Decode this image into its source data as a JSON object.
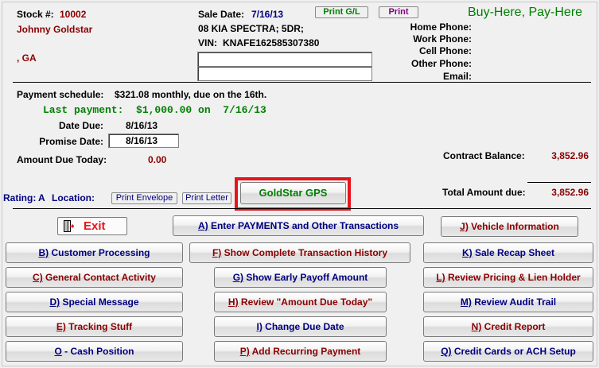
{
  "header": {
    "stock_label": "Stock #:",
    "stock_number": "10002",
    "customer_name": "Johnny Goldstar",
    "location_line": ", GA",
    "sale_date_label": "Sale Date:",
    "sale_date": "7/16/13",
    "vehicle": "08 KIA SPECTRA; 5DR;",
    "vin_label": "VIN:",
    "vin": "KNAFE162585307380",
    "print_gl_label": "Print G/L",
    "print_label": "Print",
    "brand": "Buy-Here, Pay-Here",
    "text_field_1": "",
    "text_field_2": ""
  },
  "phones": {
    "home_label": "Home Phone:",
    "work_label": "Work Phone:",
    "cell_label": "Cell Phone:",
    "other_label": "Other Phone:",
    "email_label": "Email:"
  },
  "payment": {
    "schedule_label": "Payment schedule:",
    "schedule_value": "$321.08 monthly, due on the 16th.",
    "last_payment": "Last payment:  $1,000.00 on  7/16/13",
    "date_due_label": "Date Due:",
    "date_due": "8/16/13",
    "promise_date_label": "Promise Date:",
    "promise_date": "8/16/13",
    "amount_due_label": "Amount Due Today:",
    "amount_due": "0.00",
    "contract_balance_label": "Contract Balance:",
    "contract_balance": "3,852.96",
    "total_due_label": "Total Amount due:",
    "total_due": "3,852.96"
  },
  "rating": {
    "rating_label": "Rating:",
    "rating_value": "A",
    "location_label": "Location:",
    "print_envelope": "Print Envelope",
    "print_letter": "Print Letter",
    "gps_button": "GoldStar GPS"
  },
  "actions": {
    "exit": "Exit",
    "a_key": "A)",
    "a_text": " Enter PAYMENTS and Other Transactions",
    "j_key": "J)",
    "j_text": " Vehicle Information",
    "b_key": "B)",
    "b_text": " Customer Processing",
    "f_key": "F)",
    "f_text": " Show Complete Transaction History",
    "k_key": "K)",
    "k_text": " Sale Recap Sheet",
    "c_key": "C)",
    "c_text": " General Contact Activity",
    "g_key": "G)",
    "g_text": " Show Early Payoff Amount",
    "l_key": "L)",
    "l_text": " Review Pricing & Lien Holder",
    "d_key": "D)",
    "d_text": " Special Message",
    "h_key": "H)",
    "h_text": " Review \"Amount Due Today\"",
    "m_key": "M)",
    "m_text": " Review Audit Trail",
    "e_key": "E)",
    "e_text": " Tracking Stuff",
    "i_key": "I)",
    "i_text": " Change Due Date",
    "n_key": "N)",
    "n_text": " Credit Report",
    "o_key": "O",
    "o_text": " - Cash Position",
    "p_key": "P)",
    "p_text": " Add Recurring Payment",
    "q_key": "Q)",
    "q_text": " Credit Cards or ACH Setup"
  },
  "colors": {
    "accent_red": "#e8141c",
    "maroon": "#8b0000",
    "navy": "#000080",
    "green": "#008000"
  }
}
